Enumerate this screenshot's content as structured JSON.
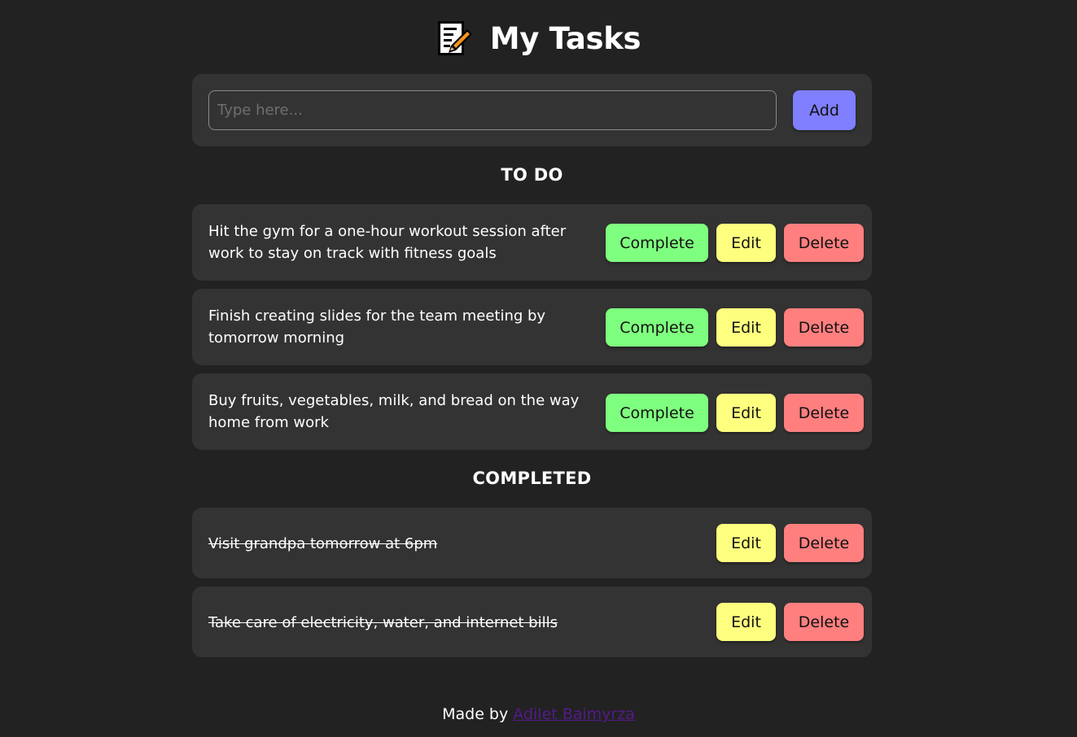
{
  "header": {
    "title": "My Tasks",
    "icon": "memo-icon"
  },
  "new_task": {
    "placeholder": "Type here...",
    "value": "",
    "add_label": "Add"
  },
  "todo": {
    "heading": "TO DO",
    "items": [
      {
        "text_line1": "Hit the gym for a one-hour workout session after",
        "text_line2": "work to stay on track with fitness goals",
        "complete_label": "Complete",
        "edit_label": "Edit",
        "delete_label": "Delete"
      },
      {
        "text_line1": "Finish creating slides for the team meeting by",
        "text_line2": "tomorrow morning",
        "complete_label": "Complete",
        "edit_label": "Edit",
        "delete_label": "Delete"
      },
      {
        "text_line1": "Buy fruits, vegetables, milk, and bread on the way",
        "text_line2": "home from work",
        "complete_label": "Complete",
        "edit_label": "Edit",
        "delete_label": "Delete"
      }
    ]
  },
  "completed": {
    "heading": "COMPLETED",
    "items": [
      {
        "text": "Visit grandpa tomorrow at 6pm",
        "edit_label": "Edit",
        "delete_label": "Delete"
      },
      {
        "text": "Take care of electricity, water, and internet bills",
        "edit_label": "Edit",
        "delete_label": "Delete"
      }
    ]
  },
  "footer": {
    "prefix": "Made by",
    "author": "Adilet Baimyrza"
  },
  "colors": {
    "background": "#222222",
    "card": "#333333",
    "add_button": "#7f7fff",
    "complete_button": "#7fff7f",
    "edit_button": "#ffff7f",
    "delete_button": "#ff7f7f",
    "link": "#551a8b"
  }
}
